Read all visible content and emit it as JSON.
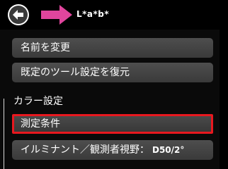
{
  "header": {
    "title": "L*a*b*",
    "back_icon": "back-arrow-icon",
    "forward_icon": "pink-arrow-icon",
    "accent_color": "#e0459d"
  },
  "menu": {
    "rename_label": "名前を変更",
    "restore_defaults_label": "既定のツール設定を復元",
    "color_settings_section": "カラー設定",
    "measurement_conditions_label": "測定条件",
    "illuminant_observer_label": "イルミナント／観測者視野：",
    "illuminant_observer_value": "D50/2°",
    "selected_highlight_color": "#e8181f"
  }
}
